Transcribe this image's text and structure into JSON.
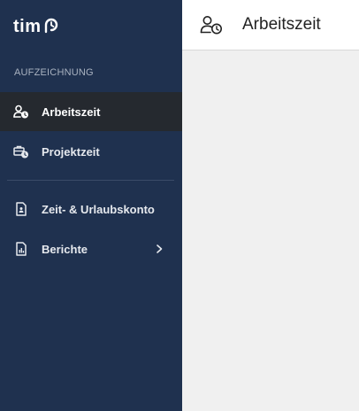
{
  "brand": {
    "logo_text": "tim",
    "logo_icon": "clock-r-icon"
  },
  "sidebar": {
    "section_label": "AUFZEICHNUNG",
    "items": [
      {
        "label": "Arbeitszeit",
        "icon": "user-clock-icon",
        "active": true
      },
      {
        "label": "Projektzeit",
        "icon": "briefcase-clock-icon",
        "active": false
      },
      {
        "label": "Zeit- & Urlaubskonto",
        "icon": "document-account-icon",
        "active": false
      },
      {
        "label": "Berichte",
        "icon": "document-chart-icon",
        "active": false,
        "has_submenu": true
      }
    ]
  },
  "header": {
    "title": "Arbeitszeit",
    "icon": "user-clock-icon"
  },
  "colors": {
    "sidebar_bg": "#1f314f",
    "active_item_bg": "#25292f",
    "content_bg": "#f0f0f0",
    "header_bg": "#ffffff"
  }
}
